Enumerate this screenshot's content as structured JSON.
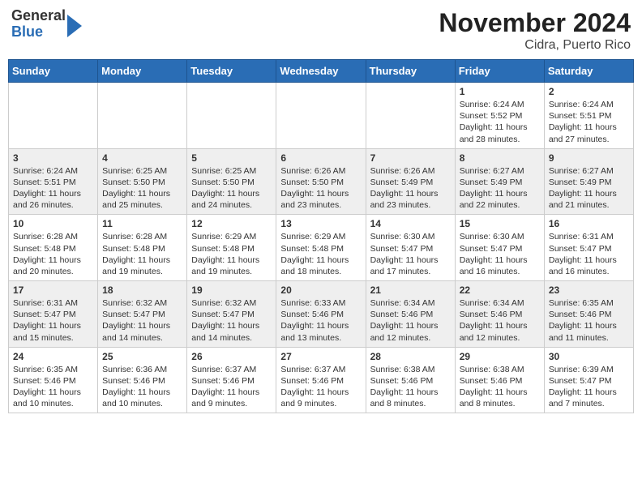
{
  "header": {
    "logo": {
      "general": "General",
      "blue": "Blue"
    },
    "title": "November 2024",
    "subtitle": "Cidra, Puerto Rico"
  },
  "days_of_week": [
    "Sunday",
    "Monday",
    "Tuesday",
    "Wednesday",
    "Thursday",
    "Friday",
    "Saturday"
  ],
  "weeks": [
    [
      {
        "day": "",
        "info": ""
      },
      {
        "day": "",
        "info": ""
      },
      {
        "day": "",
        "info": ""
      },
      {
        "day": "",
        "info": ""
      },
      {
        "day": "",
        "info": ""
      },
      {
        "day": "1",
        "info": "Sunrise: 6:24 AM\nSunset: 5:52 PM\nDaylight: 11 hours\nand 28 minutes."
      },
      {
        "day": "2",
        "info": "Sunrise: 6:24 AM\nSunset: 5:51 PM\nDaylight: 11 hours\nand 27 minutes."
      }
    ],
    [
      {
        "day": "3",
        "info": "Sunrise: 6:24 AM\nSunset: 5:51 PM\nDaylight: 11 hours\nand 26 minutes."
      },
      {
        "day": "4",
        "info": "Sunrise: 6:25 AM\nSunset: 5:50 PM\nDaylight: 11 hours\nand 25 minutes."
      },
      {
        "day": "5",
        "info": "Sunrise: 6:25 AM\nSunset: 5:50 PM\nDaylight: 11 hours\nand 24 minutes."
      },
      {
        "day": "6",
        "info": "Sunrise: 6:26 AM\nSunset: 5:50 PM\nDaylight: 11 hours\nand 23 minutes."
      },
      {
        "day": "7",
        "info": "Sunrise: 6:26 AM\nSunset: 5:49 PM\nDaylight: 11 hours\nand 23 minutes."
      },
      {
        "day": "8",
        "info": "Sunrise: 6:27 AM\nSunset: 5:49 PM\nDaylight: 11 hours\nand 22 minutes."
      },
      {
        "day": "9",
        "info": "Sunrise: 6:27 AM\nSunset: 5:49 PM\nDaylight: 11 hours\nand 21 minutes."
      }
    ],
    [
      {
        "day": "10",
        "info": "Sunrise: 6:28 AM\nSunset: 5:48 PM\nDaylight: 11 hours\nand 20 minutes."
      },
      {
        "day": "11",
        "info": "Sunrise: 6:28 AM\nSunset: 5:48 PM\nDaylight: 11 hours\nand 19 minutes."
      },
      {
        "day": "12",
        "info": "Sunrise: 6:29 AM\nSunset: 5:48 PM\nDaylight: 11 hours\nand 19 minutes."
      },
      {
        "day": "13",
        "info": "Sunrise: 6:29 AM\nSunset: 5:48 PM\nDaylight: 11 hours\nand 18 minutes."
      },
      {
        "day": "14",
        "info": "Sunrise: 6:30 AM\nSunset: 5:47 PM\nDaylight: 11 hours\nand 17 minutes."
      },
      {
        "day": "15",
        "info": "Sunrise: 6:30 AM\nSunset: 5:47 PM\nDaylight: 11 hours\nand 16 minutes."
      },
      {
        "day": "16",
        "info": "Sunrise: 6:31 AM\nSunset: 5:47 PM\nDaylight: 11 hours\nand 16 minutes."
      }
    ],
    [
      {
        "day": "17",
        "info": "Sunrise: 6:31 AM\nSunset: 5:47 PM\nDaylight: 11 hours\nand 15 minutes."
      },
      {
        "day": "18",
        "info": "Sunrise: 6:32 AM\nSunset: 5:47 PM\nDaylight: 11 hours\nand 14 minutes."
      },
      {
        "day": "19",
        "info": "Sunrise: 6:32 AM\nSunset: 5:47 PM\nDaylight: 11 hours\nand 14 minutes."
      },
      {
        "day": "20",
        "info": "Sunrise: 6:33 AM\nSunset: 5:46 PM\nDaylight: 11 hours\nand 13 minutes."
      },
      {
        "day": "21",
        "info": "Sunrise: 6:34 AM\nSunset: 5:46 PM\nDaylight: 11 hours\nand 12 minutes."
      },
      {
        "day": "22",
        "info": "Sunrise: 6:34 AM\nSunset: 5:46 PM\nDaylight: 11 hours\nand 12 minutes."
      },
      {
        "day": "23",
        "info": "Sunrise: 6:35 AM\nSunset: 5:46 PM\nDaylight: 11 hours\nand 11 minutes."
      }
    ],
    [
      {
        "day": "24",
        "info": "Sunrise: 6:35 AM\nSunset: 5:46 PM\nDaylight: 11 hours\nand 10 minutes."
      },
      {
        "day": "25",
        "info": "Sunrise: 6:36 AM\nSunset: 5:46 PM\nDaylight: 11 hours\nand 10 minutes."
      },
      {
        "day": "26",
        "info": "Sunrise: 6:37 AM\nSunset: 5:46 PM\nDaylight: 11 hours\nand 9 minutes."
      },
      {
        "day": "27",
        "info": "Sunrise: 6:37 AM\nSunset: 5:46 PM\nDaylight: 11 hours\nand 9 minutes."
      },
      {
        "day": "28",
        "info": "Sunrise: 6:38 AM\nSunset: 5:46 PM\nDaylight: 11 hours\nand 8 minutes."
      },
      {
        "day": "29",
        "info": "Sunrise: 6:38 AM\nSunset: 5:46 PM\nDaylight: 11 hours\nand 8 minutes."
      },
      {
        "day": "30",
        "info": "Sunrise: 6:39 AM\nSunset: 5:47 PM\nDaylight: 11 hours\nand 7 minutes."
      }
    ]
  ]
}
